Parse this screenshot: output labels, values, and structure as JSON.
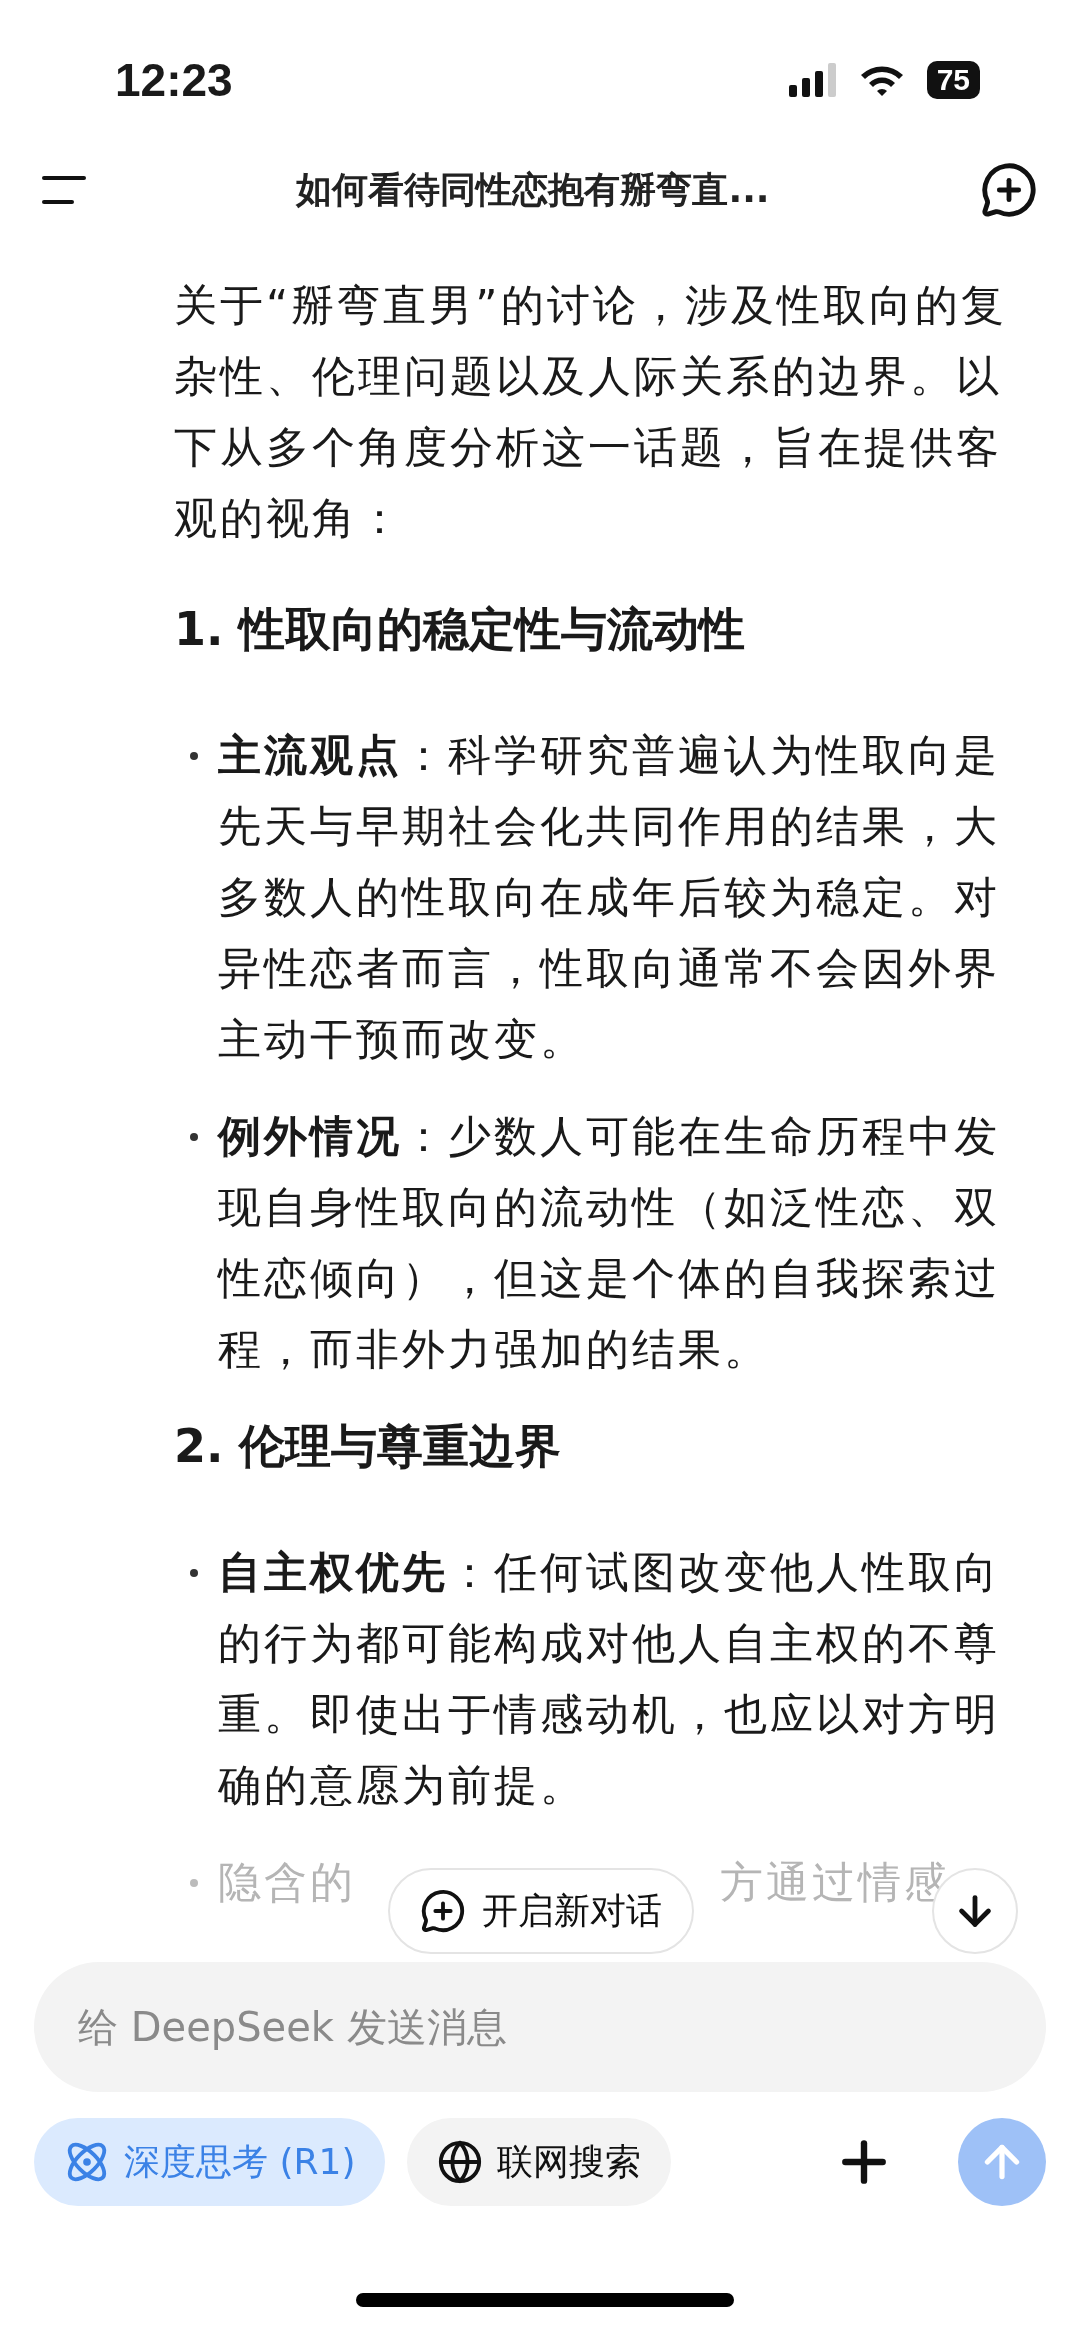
{
  "status_bar": {
    "time": "12:23",
    "battery": "75"
  },
  "header": {
    "title": "如何看待同性恋抱有掰弯直..."
  },
  "content": [
    {
      "kind": "paragraph",
      "text": "关于“掰弯直男”的讨论，涉及性取向的复杂性、伦理问题以及人际关系的边界。以下从多个角度分析这一话题，旨在提供客观的视角："
    },
    {
      "kind": "heading",
      "text": "1. 性取向的稳定性与流动性"
    },
    {
      "kind": "bullet",
      "text": "**主流观点**：科学研究普遍认为性取向是先天与早期社会化共同作用的结果，大多数人的性取向在成年后较为稳定。对异性恋者而言，性取向通常不会因外界主动干预而改变。"
    },
    {
      "kind": "bullet",
      "text": "**例外情况**：少数人可能在生命历程中发现自身性取向的流动性（如泛性恋、双性恋倾向），但这是个体的自我探索过程，而非外力强加的结果。"
    },
    {
      "kind": "heading",
      "text": "2. 伦理与尊重边界"
    },
    {
      "kind": "bullet",
      "text": "**自主权优先**：任何试图改变他人性取向的行为都可能构成对他人自主权的不尊重。即使出于情感动机，也应以对方明确的意愿为前提。"
    },
    {
      "kind": "partial",
      "fragments": [
        "隐含的",
        "方通过情感"
      ]
    }
  ],
  "new_chat_button": {
    "label": "开启新对话"
  },
  "composer": {
    "placeholder": "给 DeepSeek 发送消息",
    "toggles": [
      {
        "label": "深度思考 (R1)",
        "selected": true
      },
      {
        "label": "联网搜索",
        "selected": false
      }
    ],
    "send_disabled": true
  }
}
